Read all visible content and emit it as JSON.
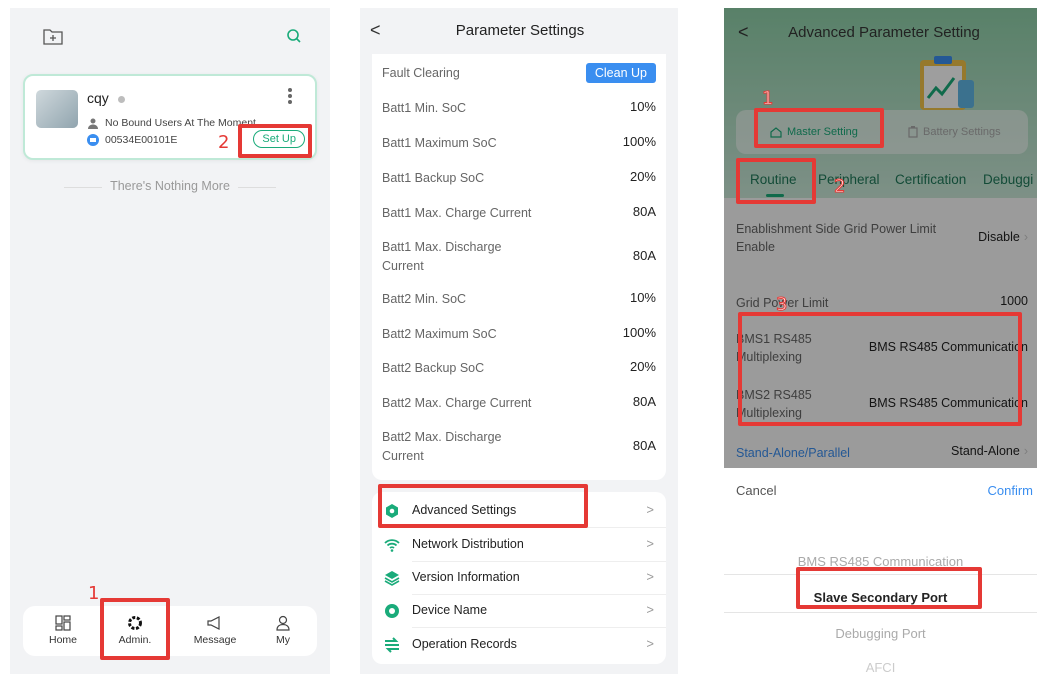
{
  "colors": {
    "accent_green": "#1aab7a",
    "button_blue": "#3a8ef0",
    "annotation_red": "#e53935",
    "header_green": "#8fd0a9"
  },
  "annotations": {
    "p1_num_1": "1",
    "p1_num_2": "2",
    "p3_num_1": "1",
    "p3_num_2": "2",
    "p3_num_3": "3"
  },
  "screen1": {
    "add_icon": "folder-add-icon",
    "search_icon": "search-icon",
    "device": {
      "name": "cqy",
      "users": "No Bound Users At The Moment",
      "serial": "00534E00101E",
      "setup_label": "Set Up"
    },
    "empty_text": "There's Nothing More",
    "tabbar": [
      {
        "label": "Home",
        "icon": "home-grid-icon"
      },
      {
        "label": "Admin.",
        "icon": "gear-icon"
      },
      {
        "label": "Message",
        "icon": "megaphone-icon"
      },
      {
        "label": "My",
        "icon": "person-icon"
      }
    ]
  },
  "screen2": {
    "back": "<",
    "title": "Parameter Settings",
    "fault_label": "Fault Clearing",
    "clean_label": "Clean Up",
    "params": [
      {
        "label": "Batt1 Min. SoC",
        "value": "10%"
      },
      {
        "label": "Batt1 Maximum SoC",
        "value": "100%"
      },
      {
        "label": "Batt1 Backup SoC",
        "value": "20%"
      },
      {
        "label": "Batt1 Max. Charge Current",
        "value": "80A"
      },
      {
        "label": "Batt1 Max. Discharge Current",
        "value": "80A"
      },
      {
        "label": "Batt2 Min. SoC",
        "value": "10%"
      },
      {
        "label": "Batt2 Maximum SoC",
        "value": "100%"
      },
      {
        "label": "Batt2 Backup SoC",
        "value": "20%"
      },
      {
        "label": "Batt2 Max. Charge Current",
        "value": "80A"
      },
      {
        "label": "Batt2 Max. Discharge Current",
        "value": "80A"
      }
    ],
    "menu": [
      {
        "label": "Advanced Settings",
        "icon": "settings-icon"
      },
      {
        "label": "Network Distribution",
        "icon": "wifi-icon"
      },
      {
        "label": "Version Information",
        "icon": "layers-icon"
      },
      {
        "label": "Device Name",
        "icon": "device-icon"
      },
      {
        "label": "Operation Records",
        "icon": "records-icon"
      }
    ],
    "arrow": ">"
  },
  "screen3": {
    "back": "<",
    "title": "Advanced Parameter Setting",
    "seg": {
      "master": "Master Setting",
      "battery": "Battery Settings"
    },
    "subtabs": [
      "Routine",
      "Peripheral",
      "Certification",
      "Debuggi"
    ],
    "rows": [
      {
        "label": "Enablishment Side Grid Power Limit Enable",
        "value": "Disable"
      },
      {
        "label": "Grid Power Limit",
        "value": "1000"
      },
      {
        "label": "BMS1 RS485 Multiplexing",
        "value": "BMS RS485 Communication"
      },
      {
        "label": "BMS2 RS485 Multiplexing",
        "value": "BMS RS485 Communication"
      },
      {
        "label": "Stand-Alone/Parallel",
        "value": "Stand-Alone"
      }
    ],
    "sheet": {
      "cancel": "Cancel",
      "confirm": "Confirm",
      "options": [
        "BMS RS485 Communication",
        "Slave Secondary Port",
        "Debugging Port",
        "AFCI"
      ],
      "selected": "Slave Secondary Port"
    }
  }
}
